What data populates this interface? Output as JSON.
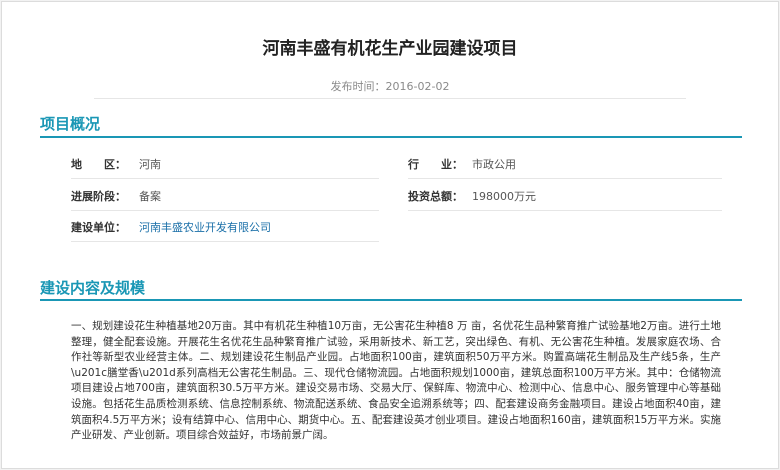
{
  "article": {
    "title": "河南丰盛有机花生产业园建设项目",
    "publish_time": "发布时间：2016-02-02"
  },
  "overview": {
    "heading": "项目概况",
    "region_label": "地　　区：",
    "region_value": "河南",
    "industry_label": "行　　业：",
    "industry_value": "市政公用",
    "stage_label": "进展阶段：",
    "stage_value": "备案",
    "investment_label": "投资总额：",
    "investment_value": "198000万元",
    "builder_label": "建设单位：",
    "builder_value": "河南丰盛农业开发有限公司"
  },
  "scope": {
    "heading": "建设内容及规模",
    "text": "一、规划建设花生种植基地20万亩。其中有机花生种植10万亩，无公害花生种植8 万 亩，名优花生品种繁育推广试验基地2万亩。进行土地整理，健全配套设施。开展花生名优花生品种繁育推广试验，采用新技术、新工艺，突出绿色、有机、无公害花生种植。发展家庭农场、合作社等新型农业经营主体。二、规划建设花生制品产业园。占地面积100亩，建筑面积50万平方米。购置高端花生制品及生产线5条，生产\\u201c膳堂香\\u201d系列高档无公害花生制品。三、现代仓储物流园。占地面积规划1000亩，建筑总面积100万平方米。其中：仓储物流项目建设占地700亩，建筑面积30.5万平方米。建设交易市场、交易大厅、保鲜库、物流中心、检测中心、信息中心、服务管理中心等基础设施。包括花生品质检测系统、信息控制系统、物流配送系统、食品安全追溯系统等；四、配套建设商务金融项目。建设占地面积40亩，建筑面积4.5万平方米；设有结算中心、信用中心、期货中心。五、配套建设英才创业项目。建设占地面积160亩，建筑面积15万平方米。实施产业研发、产业创新。项目综合效益好，市场前景广阔。"
  },
  "colors": {
    "accent": "#1a97b5",
    "link": "#1a6fa8"
  }
}
